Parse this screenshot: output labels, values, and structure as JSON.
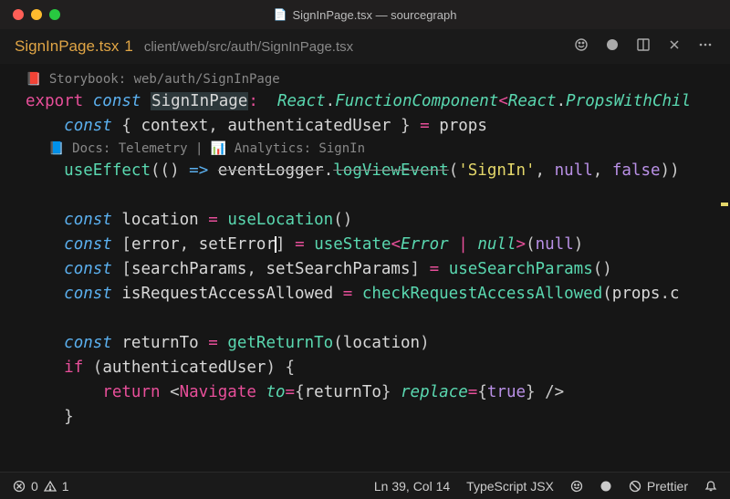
{
  "window": {
    "title": "SignInPage.tsx — sourcegraph"
  },
  "tab": {
    "label": "SignInPage.tsx",
    "modified": "1",
    "breadcrumb": "client/web/src/auth/SignInPage.tsx"
  },
  "codelens": {
    "storybook": "📕 Storybook: web/auth/SignInPage",
    "docs": "📘 Docs: Telemetry | 📊 Analytics: SignIn"
  },
  "code": {
    "l1": {
      "export": "export",
      "const": "const",
      "sp": " ",
      "name": "SignInPage",
      "colon": ":",
      "sp2": "  ",
      "react": "React",
      "dot": ".",
      "fc": "FunctionComponent",
      "lt": "<",
      "react2": "React",
      "dot2": ".",
      "pwc": "PropsWithChil"
    },
    "l2": {
      "indent": "    ",
      "const": "const",
      "sp": " ",
      "brace": "{",
      "sp2": " ",
      "ctx": "context",
      "comma": ", ",
      "au": "authenticatedUser",
      "sp3": " ",
      "rbrace": "}",
      "sp4": " ",
      "eq": "=",
      "sp5": " ",
      "props": "props"
    },
    "l3": {
      "indent": "    ",
      "fn": "useEffect",
      "lp": "(",
      "lp2": "(",
      ")": ")",
      "sp": " ",
      "arrow": "=>",
      "sp2": " ",
      "el": "eventLogger",
      "dot": ".",
      "lve": "logViewEvent",
      "lp3": "(",
      "str": "'SignIn'",
      "c": ", ",
      "null": "null",
      "c2": ", ",
      "false": "false",
      "rp": ")",
      ")2": ")"
    },
    "l4": {
      "indent": "    ",
      "const": "const",
      "sp": " ",
      "loc": "location",
      "sp2": " ",
      "eq": "=",
      "sp3": " ",
      "ul": "useLocation",
      "p": "()"
    },
    "l5": {
      "indent": "    ",
      "const": "const",
      "sp": " ",
      "lb": "[",
      "err": "error",
      "c": ", ",
      "se": "setError",
      "rb": "]",
      "sp2": " ",
      "eq": "=",
      "sp3": " ",
      "us": "useState",
      "lt": "<",
      "et": "Error",
      "sp4": " ",
      "pipe": "|",
      "sp5": " ",
      "null": "null",
      "gt": ">",
      "lp": "(",
      "null2": "null",
      "rp": ")"
    },
    "l6": {
      "indent": "    ",
      "const": "const",
      "sp": " ",
      "lb": "[",
      "sp2": "searchParams",
      "c": ", ",
      "ssp": "setSearchParams",
      "rb": "]",
      "sp3": " ",
      "eq": "=",
      "sp4": " ",
      "usp": "useSearchParams",
      "p": "()"
    },
    "l7": {
      "indent": "    ",
      "const": "const",
      "sp": " ",
      "ira": "isRequestAccessAllowed",
      "sp2": " ",
      "eq": "=",
      "sp3": " ",
      "craa": "checkRequestAccessAllowed",
      "lp": "(",
      "props": "props",
      "dot": ".",
      "c": "c"
    },
    "l8": {
      "indent": "    ",
      "const": "const",
      "sp": " ",
      "rt": "returnTo",
      "sp2": " ",
      "eq": "=",
      "sp3": " ",
      "grt": "getReturnTo",
      "lp": "(",
      "loc": "location",
      "rp": ")"
    },
    "l9": {
      "indent": "    ",
      "if": "if",
      "sp": " ",
      "lp": "(",
      "au": "authenticatedUser",
      "rp": ")",
      "sp2": " ",
      "lb": "{"
    },
    "l10": {
      "indent": "        ",
      "ret": "return",
      "sp": " ",
      "lt": "<",
      "nav": "Navigate",
      "sp2": " ",
      "to": "to",
      "eq": "=",
      "lb": "{",
      "rt": "returnTo",
      "rb": "}",
      "sp3": " ",
      "repl": "replace",
      "eq2": "=",
      "lb2": "{",
      "true": "true",
      "rb2": "}",
      "sp4": " ",
      "close": "/>"
    },
    "l11": {
      "indent": "    ",
      "rb": "}"
    }
  },
  "status": {
    "errors": "0",
    "warnings": "1",
    "cursor_line": "Ln 39, Col 14",
    "language": "TypeScript JSX",
    "prettier": "Prettier"
  }
}
